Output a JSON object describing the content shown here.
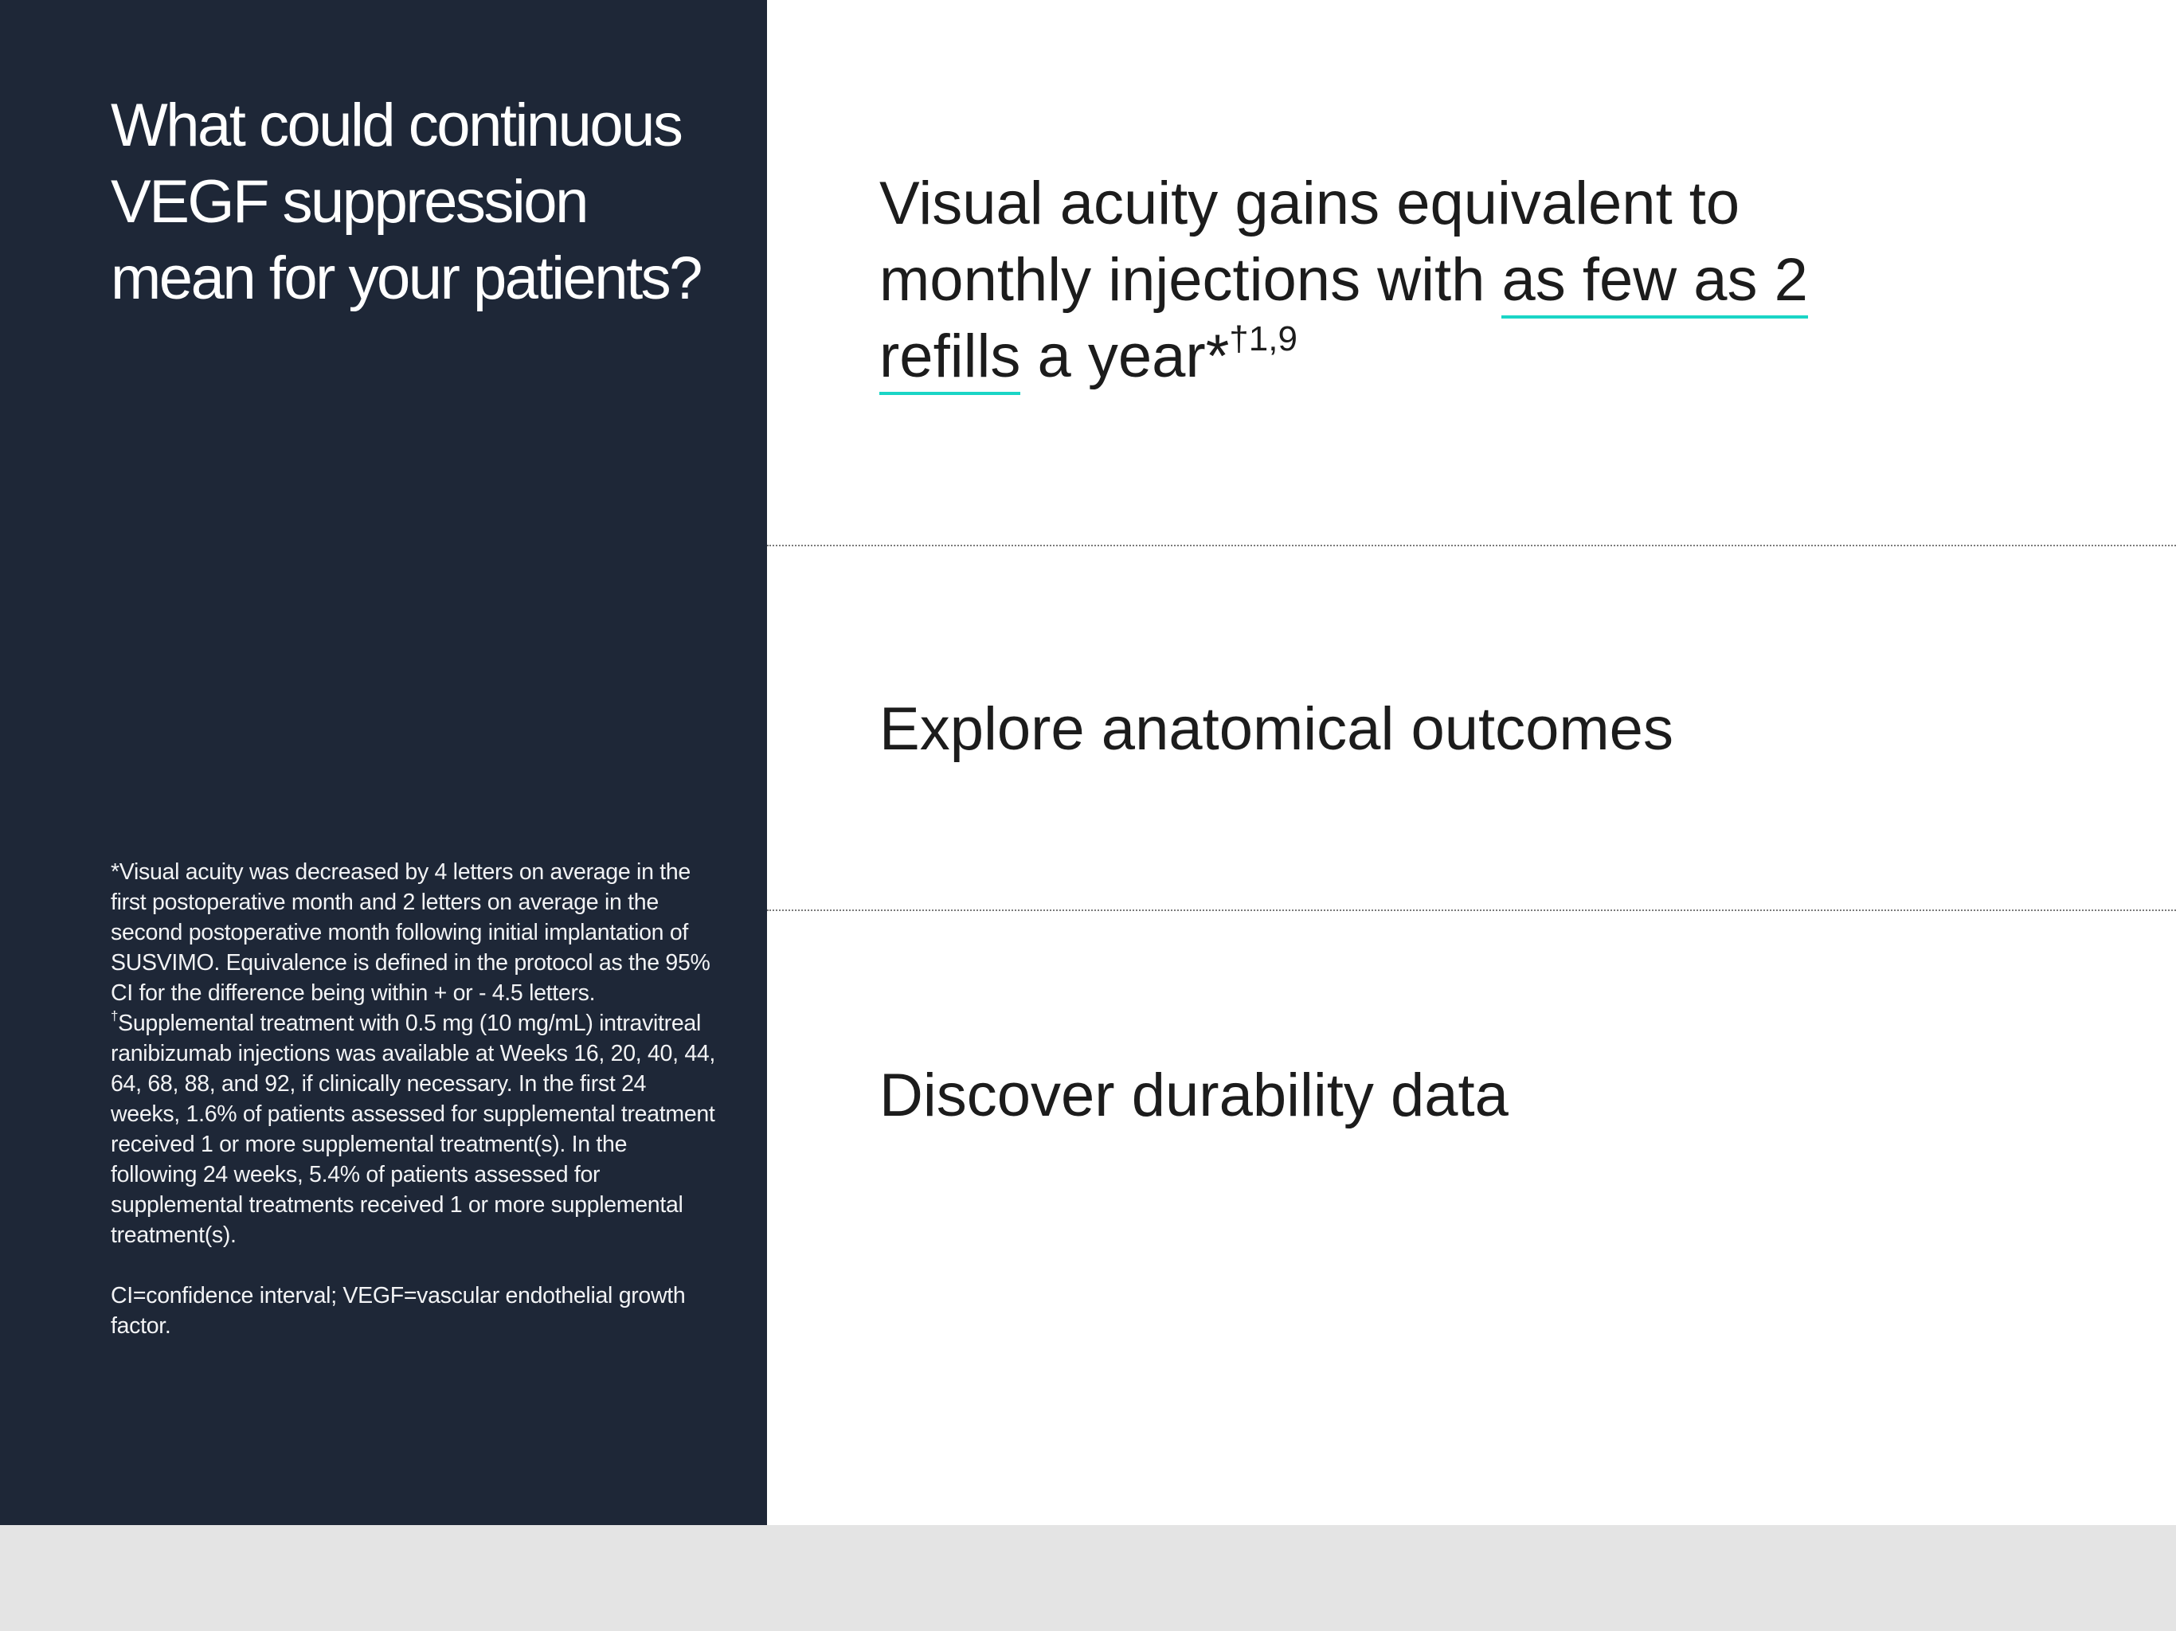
{
  "left": {
    "headline_line1": "What could continuous",
    "headline_line2": "VEGF suppression",
    "headline_line3": "mean for your patients?",
    "footnote_star": "*Visual acuity was decreased by 4 letters on average in the first postoperative month and 2 letters on average in the second postoperative month following initial implantation of SUSVIMO. Equivalence is defined in the protocol as the 95% CI for the difference being within + or - 4.5 letters.",
    "footnote_dagger_mark": "†",
    "footnote_dagger": "Supplemental treatment with 0.5 mg (10 mg/mL) intravitreal ranibizumab injections was available at Weeks 16, 20, 40, 44, 64, 68, 88, and 92, if clinically necessary. In the first 24 weeks, 1.6% of patients assessed for supplemental treatment received 1 or more supplemental treatment(s). In the following 24 weeks, 5.4% of patients assessed for supplemental treatments received 1 or more supplemental treatment(s).",
    "abbreviations": "CI=confidence interval; VEGF=vascular endothelial growth factor."
  },
  "right": {
    "claim_part1": "Visual acuity gains equivalent to monthly injections with ",
    "claim_highlight_1": "as few as 2",
    "claim_highlight_2": "refills",
    "claim_part2": " a year*",
    "claim_superscript": "†1,9",
    "link_anatomical": "Explore anatomical outcomes",
    "link_durability": "Discover durability data"
  },
  "colors": {
    "left_panel_bg": "#1e2737",
    "accent_underline": "#1ad5c6",
    "page_bg": "#e4e4e4"
  }
}
